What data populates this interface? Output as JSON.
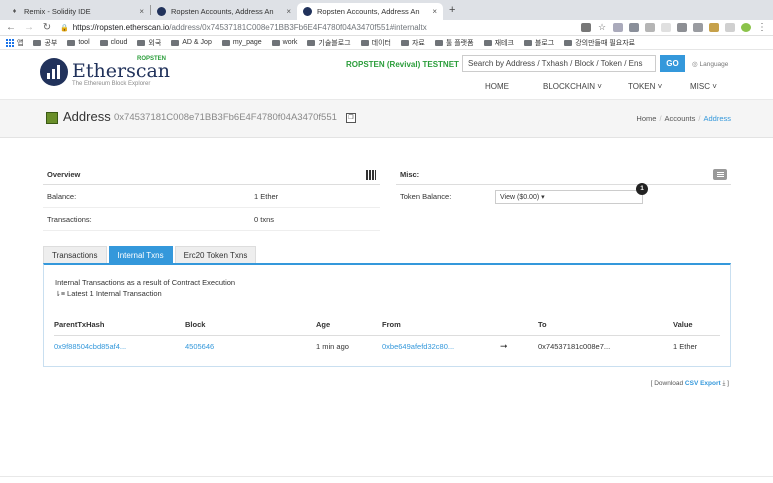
{
  "browser": {
    "tabs": [
      {
        "title": "Remix - Solidity IDE",
        "favicon": "remix-icon",
        "active": false
      },
      {
        "title": "Ropsten Accounts, Address An",
        "favicon": "etherscan-icon",
        "active": false
      },
      {
        "title": "Ropsten Accounts, Address An",
        "favicon": "etherscan-icon",
        "active": true
      }
    ],
    "close_glyph": "×",
    "new_tab_glyph": "+",
    "url_host": "https://ropsten.etherscan.io",
    "url_path": "/address/0x74537181C008e71BB3Fb6E4F4780f04A3470f551#internaltx",
    "bookmarks": [
      "앱",
      "공부",
      "tool",
      "cloud",
      "외국",
      "AD & Jop",
      "my_page",
      "work",
      "기술블로그",
      "데이터",
      "자료",
      "툴 플랫폼",
      "재테크",
      "블로그",
      "강의만들때 필요자료"
    ]
  },
  "site": {
    "logo_network": "ROPSTEN",
    "logo_name": "Etherscan",
    "logo_tagline": "The Ethereum Block Explorer",
    "network_label": "ROPSTEN (Revival) TESTNET",
    "search_placeholder": "Search by Address / Txhash / Block / Token / Ens",
    "go_label": "GO",
    "language_label": "Language",
    "menu": {
      "home": "HOME",
      "blockchain": "BLOCKCHAIN",
      "token": "TOKEN",
      "misc": "MISC"
    }
  },
  "title": {
    "label": "Address",
    "hash": "0x74537181C008e71BB3Fb6E4F4780f04A3470f551",
    "breadcrumb": [
      "Home",
      "Accounts",
      "Address"
    ]
  },
  "overview": {
    "heading": "Overview",
    "balance_label": "Balance:",
    "balance_value": "1 Ether",
    "txns_label": "Transactions:",
    "txns_value": "0 txns"
  },
  "misc": {
    "heading": "Misc:",
    "token_balance_label": "Token Balance:",
    "token_select": "View ($0.00)",
    "token_badge": "1"
  },
  "tabs": [
    "Transactions",
    "Internal Txns",
    "Erc20 Token Txns"
  ],
  "internal": {
    "intro": "Internal Transactions as a result of Contract Execution",
    "count_text": "Latest 1 Internal Transaction",
    "columns": [
      "ParentTxHash",
      "Block",
      "Age",
      "From",
      "",
      "To",
      "Value"
    ],
    "rows": [
      {
        "parent": "0x9f88504cbd85af4...",
        "block": "4505646",
        "age": "1 min ago",
        "from": "0xbe649afefd32c80...",
        "arrow": "➞",
        "to": "0x74537181c008e7...",
        "value": "1 Ether"
      }
    ]
  },
  "csv": {
    "prefix": "[ Download ",
    "link": "CSV Export",
    "suffix": " ]"
  }
}
